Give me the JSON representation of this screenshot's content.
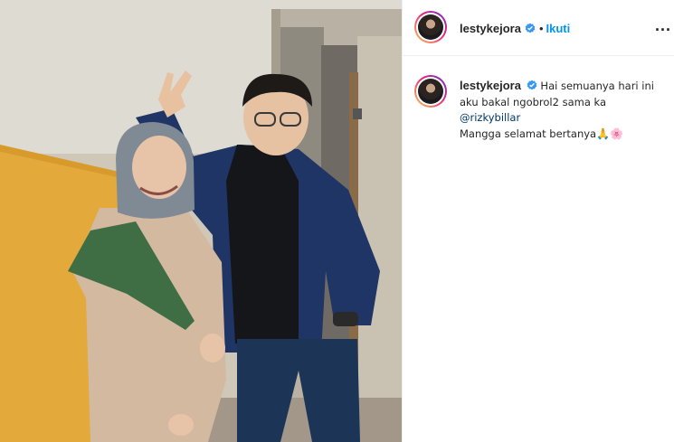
{
  "post": {
    "username": "lestykejora",
    "follow_label": "Ikuti",
    "separator": "•",
    "more_label": "...",
    "caption": {
      "line1": "Hai semuanya hari ini",
      "line2": "aku bakal ngobrol2 sama ka",
      "mention": "@rizkybillar",
      "line3": "Mangga selamat bertanya",
      "emojis": "🙏🌸"
    }
  },
  "colors": {
    "follow_blue": "#0095f6",
    "mention_blue": "#00376b",
    "verified_blue": "#3897f0"
  },
  "icons": {
    "verified": "verified-badge-icon",
    "more": "more-options-icon"
  }
}
